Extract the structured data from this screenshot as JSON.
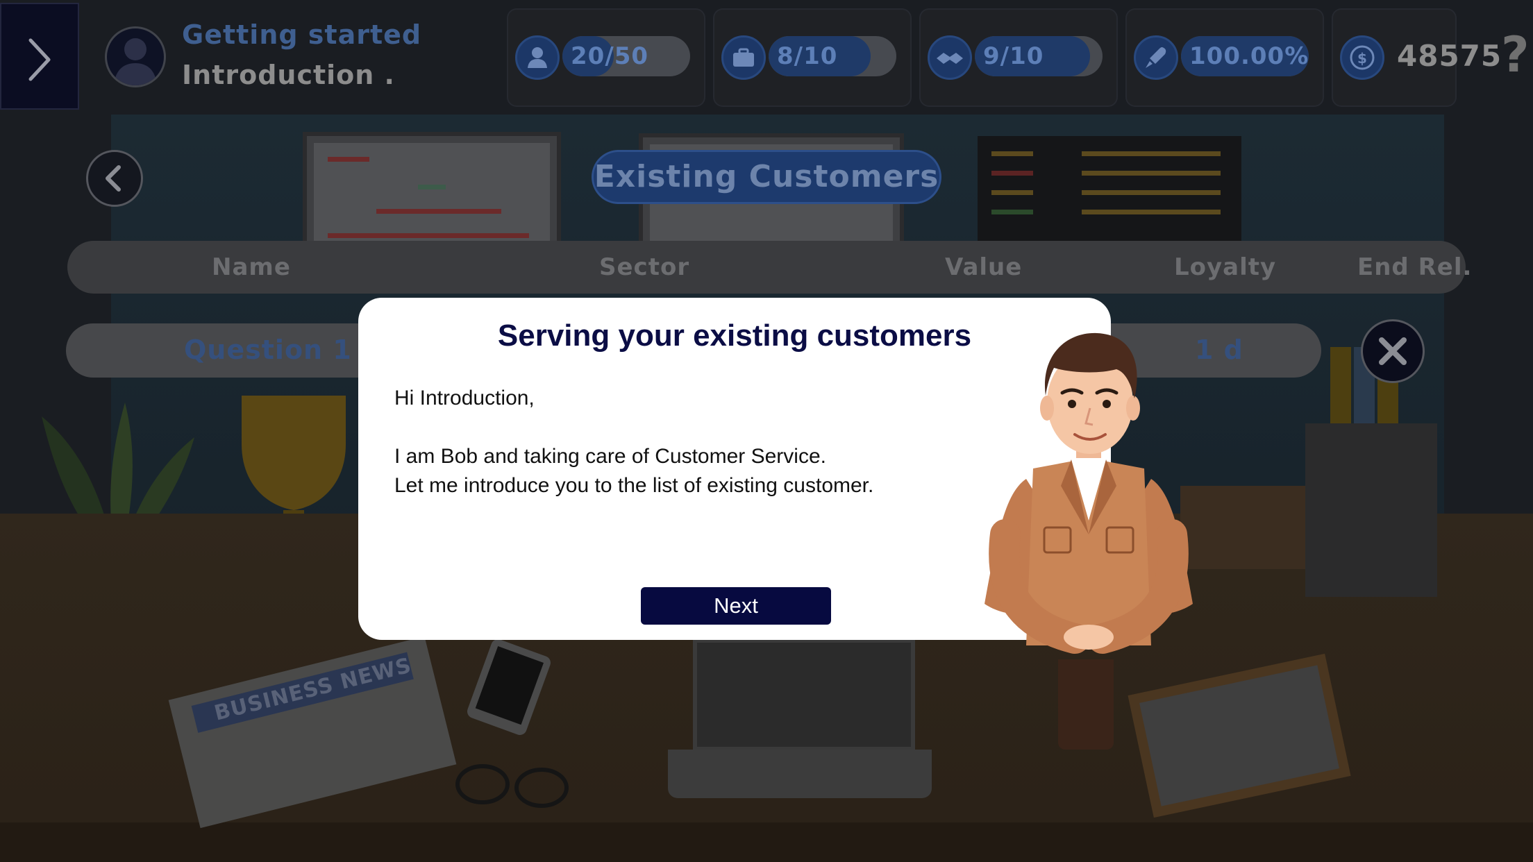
{
  "topbar": {
    "level_title": "Getting started",
    "level_subtitle": "Introduction .",
    "stats": [
      {
        "icon": "employee-icon",
        "text": "20/50",
        "fill": 0.4
      },
      {
        "icon": "briefcase-icon",
        "text": "8/10",
        "fill": 0.8
      },
      {
        "icon": "handshake-icon",
        "text": "9/10",
        "fill": 0.9
      },
      {
        "icon": "rocket-icon",
        "text": "100.00%",
        "fill": 1.0
      }
    ],
    "money": "48575",
    "help_symbol": "?"
  },
  "page": {
    "title": "Existing Customers",
    "columns": [
      "Name",
      "Sector",
      "Value",
      "Loyalty",
      "End Rel."
    ],
    "rows": [
      {
        "name": "Question 1",
        "end_rel": "1 d"
      }
    ]
  },
  "modal": {
    "title": "Serving your existing customers",
    "greeting": "Hi Introduction,",
    "line1": "I am Bob and taking care of Customer Service.",
    "line2": "Let me introduce you to the list of existing customer.",
    "next_label": "Next"
  },
  "background": {
    "newspaper_headline": "BUSINESS NEWS"
  },
  "colors": {
    "accent": "#1d3a6d",
    "modal_title": "#0b0d45",
    "next_button": "#070a40"
  }
}
